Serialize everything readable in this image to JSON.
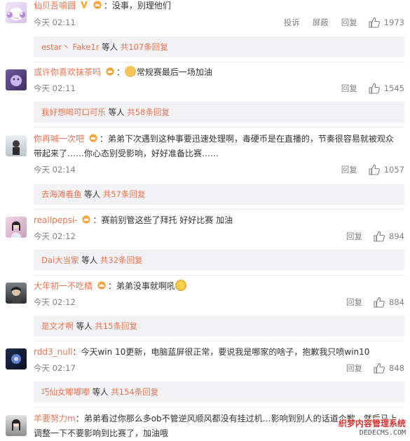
{
  "colors": {
    "accent": "#eb7350",
    "meta": "#808080",
    "reply_bg": "#f2f2f5"
  },
  "comments": [
    {
      "username": "仙贝吾喻圆",
      "text": "：没事，别理他们",
      "time": "今天 02:11",
      "actions": [
        "投诉",
        "屏蔽",
        "回复"
      ],
      "likes": "1973",
      "replies": {
        "users": "estar丶 Fake1r",
        "mid": " 等人 ",
        "count": "共107条回复"
      }
    },
    {
      "username": "或许你喜欢抹茶吗",
      "text": "常规赛最后一场加油",
      "time": "今天 02:11",
      "actions": [
        "回复"
      ],
      "likes": "1545",
      "replies": {
        "users": "我好想喝可口可乐",
        "mid": " 等人 ",
        "count": "共58条回复"
      }
    },
    {
      "username": "你再喊一次吧",
      "text": "：弟弟下次遇到这种事要迅速处理啊，毒硬币是在直播的，节奏很容易就被观众",
      "text2": "带起来了……你心态别受影响，好好准备比赛……",
      "time": "今天 02:14",
      "actions": [
        "回复"
      ],
      "likes": "1057",
      "replies": {
        "users": "去海滩看鱼",
        "mid": " 等人 ",
        "count": "共57条回复"
      }
    },
    {
      "username": "reallpepsi-",
      "text": "：赛前别管这些了拜托 好好比赛 加油",
      "time": "今天 02:12",
      "actions": [
        "回复"
      ],
      "likes": "894",
      "replies": {
        "users": "Dai大当家",
        "mid": " 等人 ",
        "count": "共32条回复"
      }
    },
    {
      "username": "大年初一不吃橘",
      "text": "：弟弟没事就啊吼",
      "time": "今天 02:12",
      "actions": [
        "回复"
      ],
      "likes": "884",
      "replies": {
        "users": "是文才啊",
        "mid": " 等人 ",
        "count": "共15条回复"
      }
    },
    {
      "username": "rdd3_null",
      "text": "：今天win 10更新，电脑蓝屏很正常，要说我是哪家的啥子，抱歉我只喷win10",
      "time": "今天 02:17",
      "actions": [
        "回复"
      ],
      "likes": "848",
      "replies": {
        "users": "巧仙女嘟嘟嘟",
        "mid": " 等人 ",
        "count": "共154条回复"
      }
    },
    {
      "username": "羊要努力m",
      "text": "：弟弟看过你那么多ob不管逆风顺风都没有挂过机…影响到别人的话道个歉，然后马上",
      "text2": "调整一下不要影响到比赛了，加油哦"
    }
  ],
  "icons": [
    "vip-badge-icon",
    "crown-badge-icon",
    "thumb-up-icon",
    "emoji-icon"
  ],
  "watermark": {
    "line1": "织梦内容管理系统",
    "line2": "DEDECMS.COM"
  }
}
